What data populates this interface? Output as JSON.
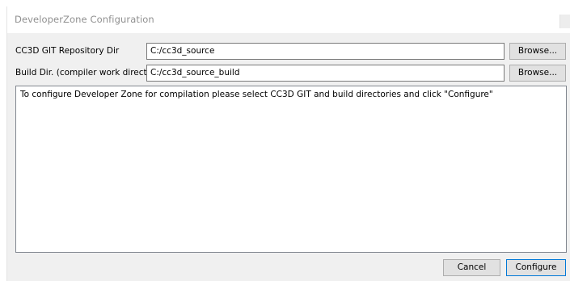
{
  "window": {
    "title": "DeveloperZone Configuration"
  },
  "git_repo": {
    "label": "CC3D GIT Repository Dir",
    "value": "C:/cc3d_source",
    "browse_label": "Browse..."
  },
  "build_dir": {
    "label": "Build Dir. (compiler work directory)",
    "value": "C:/cc3d_source_build",
    "browse_label": "Browse..."
  },
  "output": {
    "text": "To configure Developer Zone for compilation please select CC3D GIT and build directories and click \"Configure\""
  },
  "footer": {
    "cancel_label": "Cancel",
    "configure_label": "Configure"
  },
  "colors": {
    "default_button_border": "#0078d7",
    "window_bg": "#f0f0f0"
  }
}
